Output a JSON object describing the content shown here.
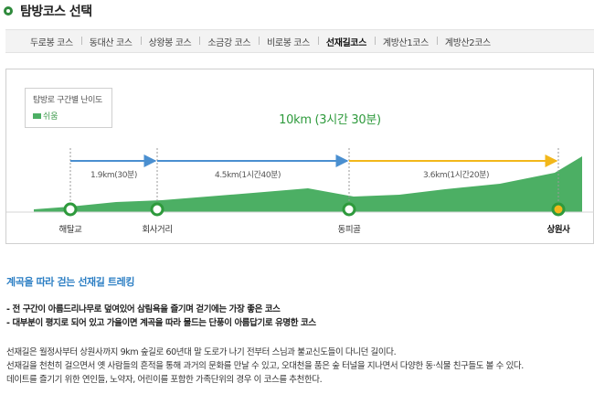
{
  "page": {
    "title": "탐방코스 선택"
  },
  "tabs": [
    {
      "label": "두로봉 코스",
      "active": false
    },
    {
      "label": "동대산 코스",
      "active": false
    },
    {
      "label": "상왕봉 코스",
      "active": false
    },
    {
      "label": "소금강 코스",
      "active": false
    },
    {
      "label": "비로봉 코스",
      "active": false
    },
    {
      "label": "선재길코스",
      "active": true
    },
    {
      "label": "계방산1코스",
      "active": false
    },
    {
      "label": "계방산2코스",
      "active": false
    }
  ],
  "course": {
    "legend": {
      "title": "탐방로 구간별 난이도",
      "item": "쉬움"
    },
    "total": "10km (3시간 30분)",
    "segments": [
      {
        "label": "1.9km(30분)",
        "color": "#4a8fd0"
      },
      {
        "label": "4.5km(1시간40분)",
        "color": "#4a8fd0"
      },
      {
        "label": "3.6km(1시간20분)",
        "color": "#f2b71a"
      }
    ],
    "stations": [
      {
        "name": "해탈교"
      },
      {
        "name": "회사거리"
      },
      {
        "name": "동피골"
      },
      {
        "name": "상원사"
      }
    ],
    "colors": {
      "terrain": "#4caf64",
      "marker_ring": "#2e9a3c",
      "destination_fill": "#f2b71a",
      "accent_text": "#2e9a3c"
    }
  },
  "content": {
    "heading": "계곡을 따라 걷는 선재길 트레킹",
    "bullets": [
      "- 전 구간이 아름드리나무로 덮여있어 삼림욕을 즐기며 걷기에는 가장 좋은 코스",
      "- 대부분이 평지로 되어 있고 가을이면 계곡을 따라 물드는 단풍이 아름답기로 유명한 코스"
    ],
    "paragraphs": [
      "선재길은 월정사부터 상원사까지 9km 숲길로 60년대 말 도로가 나기 전부터 스님과 불교신도들이 다니던 길이다.",
      "선재길을 천천히 걸으면서 옛 사람들의 흔적을 통해 과거의 문화를 만날 수 있고, 오대천을 품은 숲 터널을 지나면서 다양한 동·식물 친구들도 볼 수 있다.",
      "데이트를 즐기기 위한 연인들, 노약자, 어린이를 포함한 가족단위의 경우 이 코스를 추천한다."
    ]
  }
}
